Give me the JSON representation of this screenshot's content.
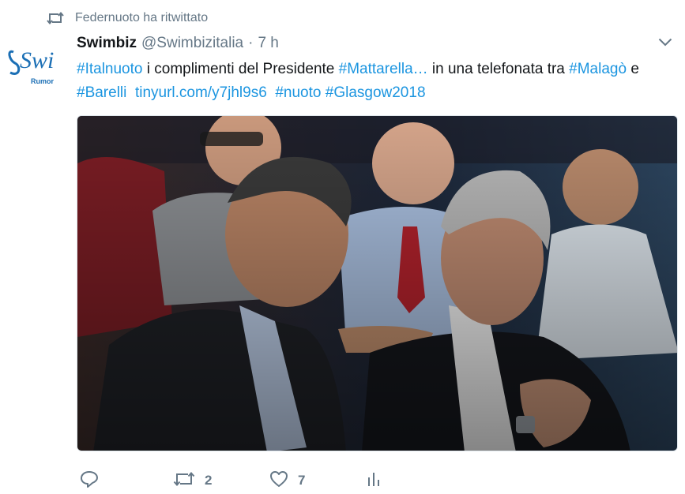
{
  "retweet_context": {
    "text": "Federnuoto ha ritwittato",
    "icon": "retweet-icon"
  },
  "tweet": {
    "avatar_text": "Swi",
    "avatar_sub": "Rumor",
    "display_name": "Swimbiz",
    "handle": "@Swimbizitalia",
    "dot": "·",
    "time": "7 h",
    "text_parts": [
      {
        "type": "hashtag",
        "text": "#Italnuoto"
      },
      {
        "type": "text",
        "text": " i complimenti del Presidente "
      },
      {
        "type": "hashtag",
        "text": "#Mattarella…"
      },
      {
        "type": "text",
        "text": " in una telefonata tra "
      },
      {
        "type": "hashtag",
        "text": "#Malagò"
      },
      {
        "type": "text",
        "text": " e "
      },
      {
        "type": "hashtag",
        "text": "#Barelli"
      },
      {
        "type": "text",
        "text": "  "
      },
      {
        "type": "link",
        "text": "tinyurl.com/y7jhl9s6"
      },
      {
        "type": "text",
        "text": "  "
      },
      {
        "type": "hashtag",
        "text": "#nuoto"
      },
      {
        "type": "text",
        "text": " "
      },
      {
        "type": "hashtag",
        "text": "#Glasgow2018"
      }
    ],
    "image_alt": "photo",
    "actions": {
      "reply": {
        "icon": "reply-icon",
        "count": ""
      },
      "retweet": {
        "icon": "retweet-icon",
        "count": "2"
      },
      "like": {
        "icon": "heart-icon",
        "count": "7"
      },
      "analytics": {
        "icon": "analytics-icon",
        "count": ""
      }
    }
  },
  "colors": {
    "link": "#1b95e0",
    "meta": "#657786",
    "text": "#14171a",
    "border": "#e1e8ed"
  }
}
